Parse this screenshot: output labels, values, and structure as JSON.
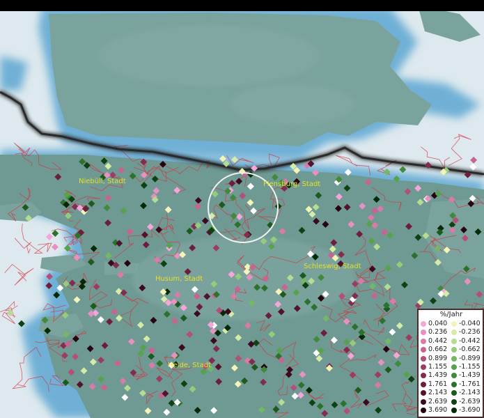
{
  "map": {
    "places": [
      {
        "name": "Niebüll, Stadt"
      },
      {
        "name": "Flensburg, Stadt"
      },
      {
        "name": "Schleswig, Stadt"
      },
      {
        "name": "Husum, Stadt"
      },
      {
        "name": "Heide, Stadt"
      }
    ],
    "colors": {
      "sea": "#dde9ee",
      "land": "#6f9a94",
      "shelf": "#7ab2d2",
      "border": "#1a1a1a",
      "district_lines": "#d8303a",
      "label": "#e6e020"
    }
  },
  "legend": {
    "title": "%/Jahr",
    "positive": [
      {
        "value": "0.040",
        "color": "#f4a6d8"
      },
      {
        "value": "0.236",
        "color": "#e890c0"
      },
      {
        "value": "0.442",
        "color": "#d97aa8"
      },
      {
        "value": "0.662",
        "color": "#c86490"
      },
      {
        "value": "0.899",
        "color": "#b34f78"
      },
      {
        "value": "1.155",
        "color": "#9c3c62"
      },
      {
        "value": "1.439",
        "color": "#842c4e"
      },
      {
        "value": "1.761",
        "color": "#6c1e3c"
      },
      {
        "value": "2.143",
        "color": "#54132c"
      },
      {
        "value": "2.639",
        "color": "#3c0a1e"
      },
      {
        "value": "3.690",
        "color": "#260410"
      }
    ],
    "negative": [
      {
        "value": "-0.040",
        "color": "#f4f4b8"
      },
      {
        "value": "-0.236",
        "color": "#d4eca8"
      },
      {
        "value": "-0.442",
        "color": "#b4dc92"
      },
      {
        "value": "-0.662",
        "color": "#94cc7c"
      },
      {
        "value": "-0.899",
        "color": "#74b866"
      },
      {
        "value": "-1.155",
        "color": "#58a24e"
      },
      {
        "value": "-1.439",
        "color": "#408a3c"
      },
      {
        "value": "-1.761",
        "color": "#2c722c"
      },
      {
        "value": "-2.143",
        "color": "#1c5a1e"
      },
      {
        "value": "-2.639",
        "color": "#0e4212"
      },
      {
        "value": "-3.690",
        "color": "#042a08"
      }
    ]
  }
}
